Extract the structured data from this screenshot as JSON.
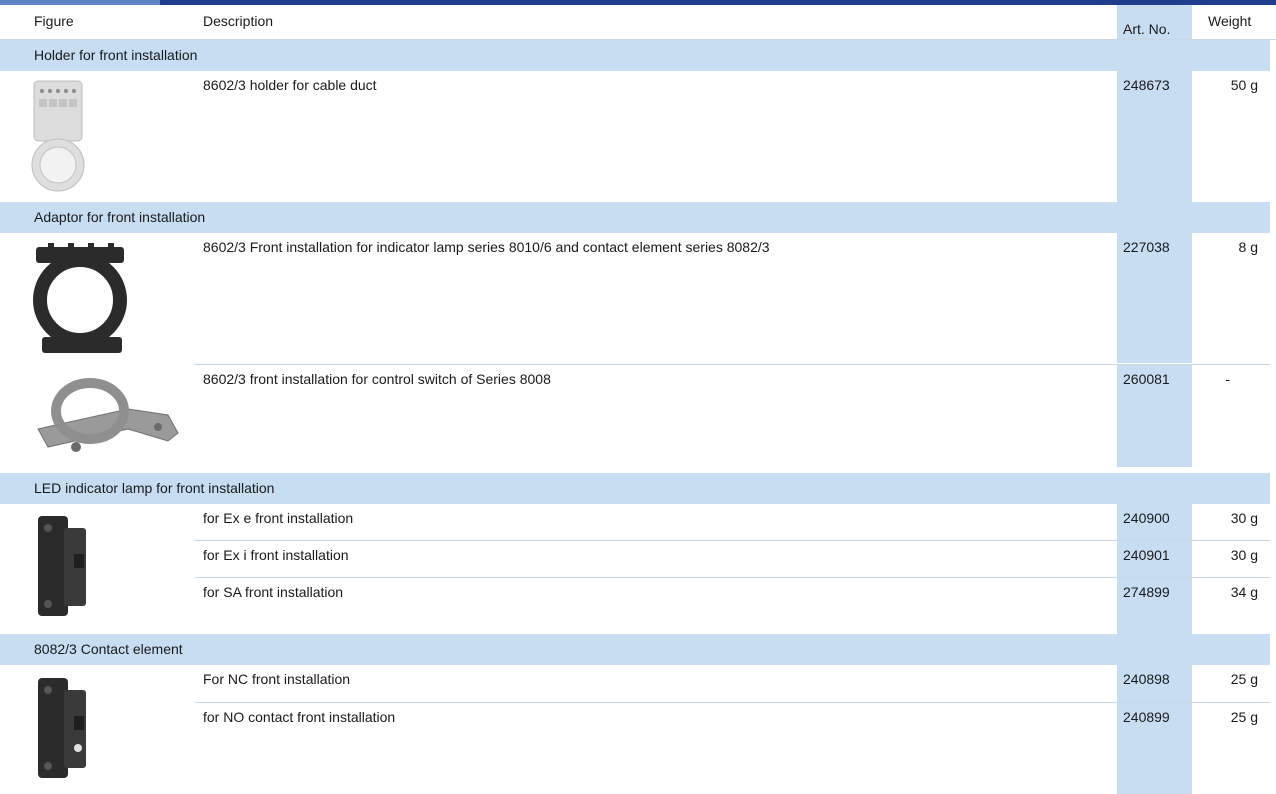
{
  "header": {
    "figure": "Figure",
    "description": "Description",
    "art_no": "Art. No.",
    "weight": "Weight"
  },
  "sections": [
    {
      "title": "Holder for front installation",
      "items": [
        {
          "image": "holder-image",
          "description": "8602/3 holder for cable duct",
          "art_no": "248673",
          "weight": "50 g"
        }
      ]
    },
    {
      "title": "Adaptor for front installation",
      "items": [
        {
          "image": "adaptor-image",
          "description": "8602/3 Front installation for indicator lamp series 8010/6 and contact element series 8082/3",
          "art_no": "227038",
          "weight": "8 g"
        },
        {
          "image": "bracket-image",
          "description": "8602/3 front installation for control switch of Series 8008",
          "art_no": "260081",
          "weight": "-"
        }
      ]
    },
    {
      "title": "LED indicator lamp for front installation",
      "items": [
        {
          "image": "led-lamp-image",
          "description": "for Ex e front installation",
          "art_no": "240900",
          "weight": "30 g"
        },
        {
          "description": "for Ex i front installation",
          "art_no": "240901",
          "weight": "30 g"
        },
        {
          "description": "for SA front installation",
          "art_no": "274899",
          "weight": "34 g"
        }
      ]
    },
    {
      "title": "8082/3 Contact element",
      "items": [
        {
          "image": "contact-element-image",
          "description": "For NC front installation",
          "art_no": "240898",
          "weight": "25 g"
        },
        {
          "description": "for NO contact front installation",
          "art_no": "240899",
          "weight": "25 g"
        }
      ]
    }
  ],
  "colors": {
    "top_bar": "#1f3d8c",
    "section_band": "#c8ddf2",
    "divider": "#c9d6e6"
  }
}
